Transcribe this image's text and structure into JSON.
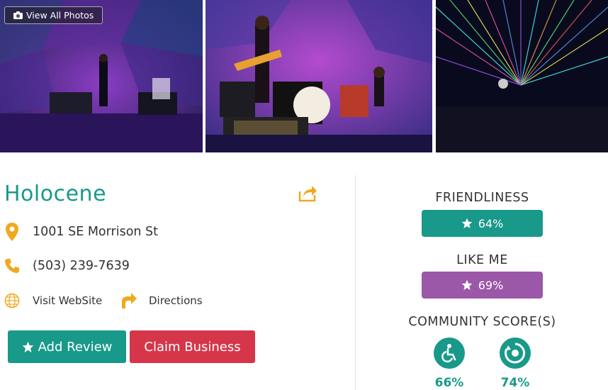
{
  "gallery": {
    "view_all_label": "View All Photos",
    "photos": [
      {
        "name": "stage-photo-1"
      },
      {
        "name": "stage-photo-2"
      },
      {
        "name": "stage-photo-3"
      }
    ]
  },
  "business": {
    "name": "Holocene",
    "address": "1001 SE Morrison St",
    "phone": "(503) 239-7639",
    "website_label": "Visit WebSite",
    "directions_label": "Directions"
  },
  "actions": {
    "add_review": "Add Review",
    "claim_business": "Claim Business"
  },
  "ratings": {
    "friendliness_label": "FRIENDLINESS",
    "friendliness_value": "64%",
    "like_me_label": "LIKE ME",
    "like_me_value": "69%",
    "community_label": "COMMUNITY SCORE(S)",
    "scores": [
      {
        "icon": "wheelchair-icon",
        "value": "66%"
      },
      {
        "icon": "ring-icon",
        "value": "74%"
      }
    ]
  },
  "colors": {
    "teal": "#18998a",
    "purple": "#9b57a8",
    "red": "#d6364a",
    "orange": "#f0a91e"
  }
}
